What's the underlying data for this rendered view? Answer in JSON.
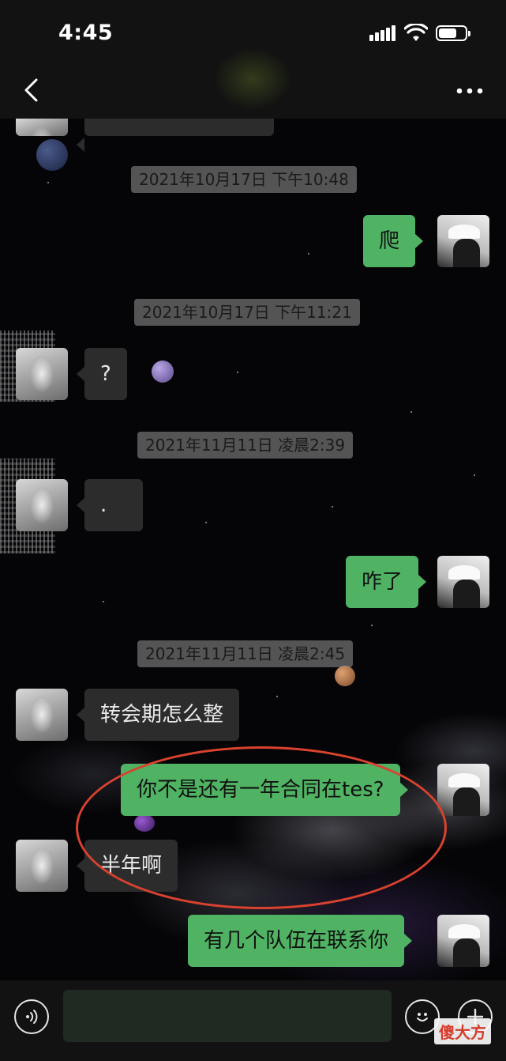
{
  "status_bar": {
    "time": "4:45"
  },
  "icons": {
    "back": "chevron-left-icon",
    "more": "ellipsis-icon",
    "voice": "voice-icon",
    "emoji": "emoji-icon",
    "plus": "plus-icon",
    "signal": "signal-icon",
    "wifi": "wifi-icon",
    "battery": "battery-icon"
  },
  "colors": {
    "outgoing_bubble": "#4fb363",
    "incoming_bubble": "#2c2c2c",
    "timestamp_bg": "#969696",
    "highlight": "#d9422f"
  },
  "messages": [
    {
      "type": "time",
      "text": "2021年10月17日 下午10:48"
    },
    {
      "type": "out",
      "text": "爬"
    },
    {
      "type": "time",
      "text": "2021年10月17日 下午11:21"
    },
    {
      "type": "in",
      "text": "?"
    },
    {
      "type": "time",
      "text": "2021年11月11日 凌晨2:39"
    },
    {
      "type": "in",
      "text": "."
    },
    {
      "type": "out",
      "text": "咋了"
    },
    {
      "type": "time",
      "text": "2021年11月11日 凌晨2:45"
    },
    {
      "type": "in",
      "text": "转会期怎么整"
    },
    {
      "type": "out",
      "text": "你不是还有一年合同在tes?"
    },
    {
      "type": "in",
      "text": "半年啊"
    },
    {
      "type": "out",
      "text": "有几个队伍在联系你"
    }
  ],
  "input_bar": {
    "placeholder": ""
  },
  "watermark": "傻大方"
}
